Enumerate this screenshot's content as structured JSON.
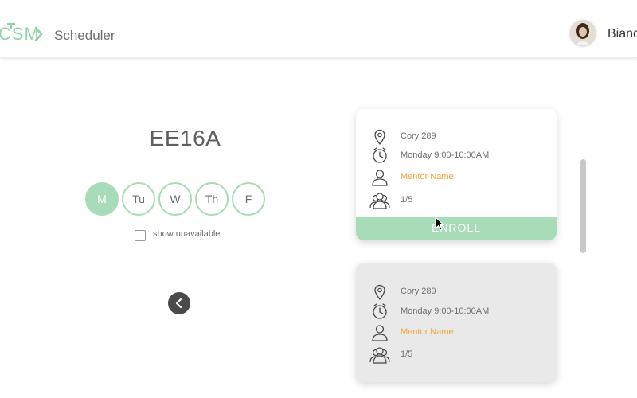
{
  "header": {
    "logo_text": "CSM",
    "app_title": "Scheduler",
    "user_name": "Bianca"
  },
  "course": {
    "title": "EE16A"
  },
  "days": [
    {
      "label": "M",
      "active": true
    },
    {
      "label": "Tu",
      "active": false
    },
    {
      "label": "W",
      "active": false
    },
    {
      "label": "Th",
      "active": false
    },
    {
      "label": "F",
      "active": false
    }
  ],
  "filters": {
    "show_unavailable_label": "show unavailable",
    "show_unavailable_checked": false
  },
  "sections": [
    {
      "location": "Cory 289",
      "time": "Monday 9:00-10:00AM",
      "mentor": "Mentor Name",
      "capacity": "1/5",
      "enroll_label": "ENROLL"
    },
    {
      "location": "Cory 289",
      "time": "Monday 9:00-10:00AM",
      "mentor": "Mentor Name",
      "capacity": "1/5"
    }
  ],
  "colors": {
    "accent_green": "#a8dcb8",
    "mentor_orange": "#f0a63c",
    "card_disabled": "#e9e9e9"
  },
  "icons": [
    "location-pin-icon",
    "clock-icon",
    "person-icon",
    "group-icon",
    "chevron-left-icon"
  ]
}
